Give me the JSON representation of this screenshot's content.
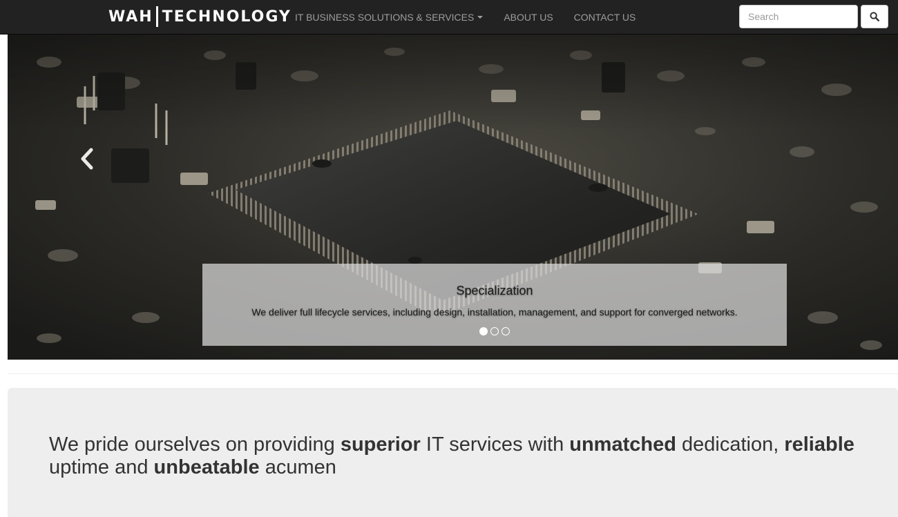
{
  "navbar": {
    "brand_left": "WAH",
    "brand_right": "TECHNOLOGY",
    "links": [
      {
        "label": "IT BUSINESS SOLUTIONS & SERVICES",
        "dropdown": true
      },
      {
        "label": "ABOUT US",
        "dropdown": false
      },
      {
        "label": "CONTACT US",
        "dropdown": false
      }
    ],
    "search": {
      "placeholder": "Search",
      "value": ""
    },
    "search_button_icon": "search-icon"
  },
  "carousel": {
    "background": "circuit-board-photo",
    "prev_icon": "chevron-left-icon",
    "caption": {
      "title": "Specialization",
      "text": "We deliver full lifecycle services, including design, installation, management, and support for converged networks."
    },
    "slide_count": 3,
    "active_slide": 1
  },
  "jumbotron": {
    "segments": [
      {
        "text": "We pride ourselves on providing ",
        "bold": false
      },
      {
        "text": "superior",
        "bold": true
      },
      {
        "text": " IT services with ",
        "bold": false
      },
      {
        "text": "unmatched",
        "bold": true
      },
      {
        "text": " dedication, ",
        "bold": false
      },
      {
        "text": "reliable",
        "bold": true
      },
      {
        "text": " uptime and ",
        "bold": false
      },
      {
        "text": "unbeatable",
        "bold": true
      },
      {
        "text": " acumen",
        "bold": false
      }
    ]
  },
  "colors": {
    "navbar_bg": "#222222",
    "nav_link": "#9d9d9d",
    "jumbotron_bg": "#eeeeee",
    "text_dark": "#333333"
  }
}
